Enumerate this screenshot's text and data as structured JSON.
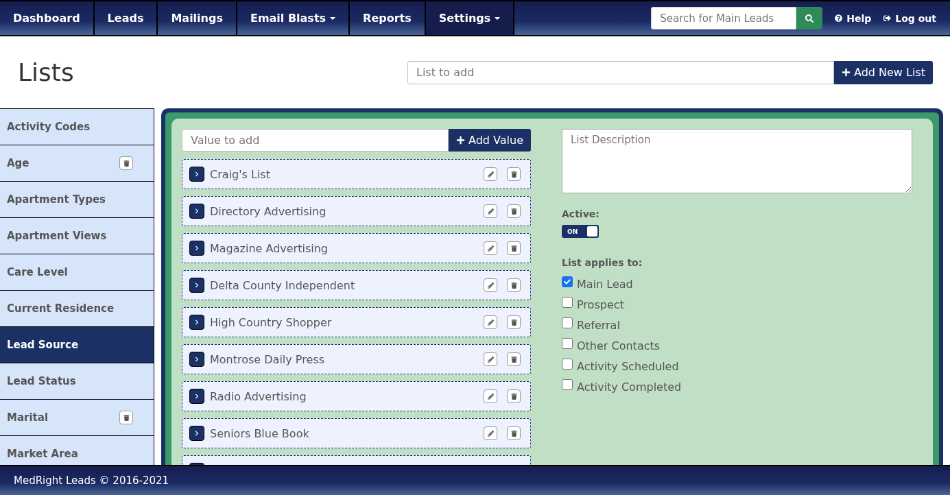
{
  "nav": {
    "items": [
      {
        "label": "Dashboard",
        "dropdown": false,
        "selected": false
      },
      {
        "label": "Leads",
        "dropdown": false,
        "selected": false
      },
      {
        "label": "Mailings",
        "dropdown": false,
        "selected": false
      },
      {
        "label": "Email Blasts",
        "dropdown": true,
        "selected": false
      },
      {
        "label": "Reports",
        "dropdown": false,
        "selected": false
      },
      {
        "label": "Settings",
        "dropdown": true,
        "selected": true
      }
    ],
    "search": {
      "placeholder": "Search for Main Leads"
    },
    "links": [
      {
        "kind": "help",
        "label": "Help"
      },
      {
        "kind": "logout",
        "label": "Log out"
      }
    ]
  },
  "page": {
    "title": "Lists",
    "new_list": {
      "placeholder": "List to add",
      "button": "Add New List"
    }
  },
  "sidebar": {
    "items": [
      {
        "label": "Activity Codes",
        "deletable": false,
        "selected": false
      },
      {
        "label": "Age",
        "deletable": true,
        "selected": false
      },
      {
        "label": "Apartment Types",
        "deletable": false,
        "selected": false
      },
      {
        "label": "Apartment Views",
        "deletable": false,
        "selected": false
      },
      {
        "label": "Care Level",
        "deletable": false,
        "selected": false
      },
      {
        "label": "Current Residence",
        "deletable": false,
        "selected": false
      },
      {
        "label": "Lead Source",
        "deletable": false,
        "selected": true
      },
      {
        "label": "Lead Status",
        "deletable": false,
        "selected": false
      },
      {
        "label": "Marital",
        "deletable": true,
        "selected": false
      },
      {
        "label": "Market Area",
        "deletable": false,
        "selected": false
      }
    ]
  },
  "values": {
    "placeholder": "Value to add",
    "button": "Add Value",
    "items": [
      "Craig's List",
      "Directory Advertising",
      "Magazine Advertising",
      "Delta County Independent",
      "High Country Shopper",
      "Montrose Daily Press",
      "Radio Advertising",
      "Seniors Blue Book"
    ]
  },
  "details": {
    "description_placeholder": "List Description",
    "active_label": "Active:",
    "active": {
      "on": true,
      "label": "ON"
    },
    "applies_label": "List applies to:",
    "applies": [
      {
        "label": "Main Lead",
        "checked": true
      },
      {
        "label": "Prospect",
        "checked": false
      },
      {
        "label": "Referral",
        "checked": false
      },
      {
        "label": "Other Contacts",
        "checked": false
      },
      {
        "label": "Activity Scheduled",
        "checked": false
      },
      {
        "label": "Activity Completed",
        "checked": false
      }
    ]
  },
  "footer": {
    "text": "MedRight Leads © 2016-2021"
  }
}
